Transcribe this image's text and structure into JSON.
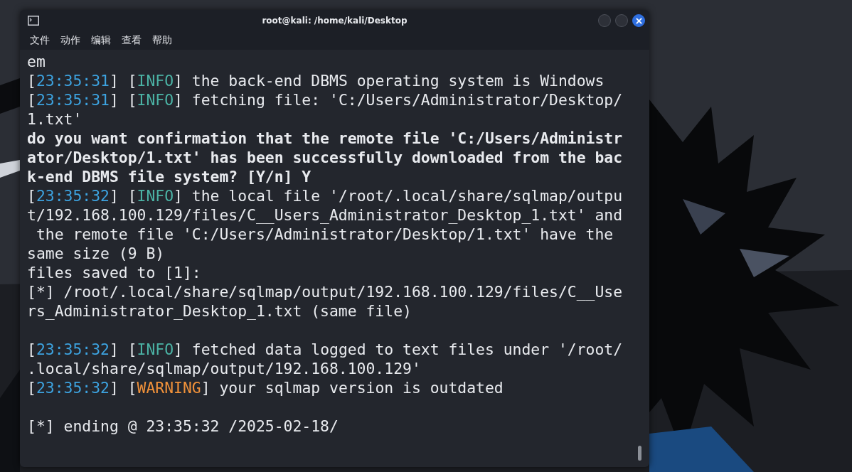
{
  "window": {
    "title": "root@kali: /home/kali/Desktop"
  },
  "menu": [
    "文件",
    "动作",
    "编辑",
    "查看",
    "帮助"
  ],
  "lines": [
    {
      "kind": "text",
      "segments": [
        {
          "kind": "plain",
          "text": "em"
        }
      ]
    },
    {
      "kind": "text",
      "segments": [
        {
          "kind": "plain",
          "text": "["
        },
        {
          "kind": "time",
          "text": "23:35:31"
        },
        {
          "kind": "plain",
          "text": "] ["
        },
        {
          "kind": "info",
          "text": "INFO"
        },
        {
          "kind": "plain",
          "text": "] the back-end DBMS operating system is Windows"
        }
      ]
    },
    {
      "kind": "text",
      "segments": [
        {
          "kind": "plain",
          "text": "["
        },
        {
          "kind": "time",
          "text": "23:35:31"
        },
        {
          "kind": "plain",
          "text": "] ["
        },
        {
          "kind": "info",
          "text": "INFO"
        },
        {
          "kind": "plain",
          "text": "] fetching file: 'C:/Users/Administrator/Desktop/"
        }
      ]
    },
    {
      "kind": "text",
      "segments": [
        {
          "kind": "plain",
          "text": "1.txt'"
        }
      ]
    },
    {
      "kind": "bold",
      "segments": [
        {
          "kind": "plain",
          "text": "do you want confirmation that the remote file 'C:/Users/Administr"
        }
      ]
    },
    {
      "kind": "bold",
      "segments": [
        {
          "kind": "plain",
          "text": "ator/Desktop/1.txt' has been successfully downloaded from the bac"
        }
      ]
    },
    {
      "kind": "bold",
      "segments": [
        {
          "kind": "plain",
          "text": "k-end DBMS file system? [Y/n] Y"
        }
      ]
    },
    {
      "kind": "text",
      "segments": [
        {
          "kind": "plain",
          "text": "["
        },
        {
          "kind": "time",
          "text": "23:35:32"
        },
        {
          "kind": "plain",
          "text": "] ["
        },
        {
          "kind": "info",
          "text": "INFO"
        },
        {
          "kind": "plain",
          "text": "] the local file '/root/.local/share/sqlmap/outpu"
        }
      ]
    },
    {
      "kind": "text",
      "segments": [
        {
          "kind": "plain",
          "text": "t/192.168.100.129/files/C__Users_Administrator_Desktop_1.txt' and"
        }
      ]
    },
    {
      "kind": "text",
      "segments": [
        {
          "kind": "plain",
          "text": " the remote file 'C:/Users/Administrator/Desktop/1.txt' have the"
        }
      ]
    },
    {
      "kind": "text",
      "segments": [
        {
          "kind": "plain",
          "text": "same size (9 B)"
        }
      ]
    },
    {
      "kind": "text",
      "segments": [
        {
          "kind": "plain",
          "text": "files saved to [1]:"
        }
      ]
    },
    {
      "kind": "text",
      "segments": [
        {
          "kind": "plain",
          "text": "[*] /root/.local/share/sqlmap/output/192.168.100.129/files/C__Use"
        }
      ]
    },
    {
      "kind": "text",
      "segments": [
        {
          "kind": "plain",
          "text": "rs_Administrator_Desktop_1.txt (same file)"
        }
      ]
    },
    {
      "kind": "blank"
    },
    {
      "kind": "text",
      "segments": [
        {
          "kind": "plain",
          "text": "["
        },
        {
          "kind": "time",
          "text": "23:35:32"
        },
        {
          "kind": "plain",
          "text": "] ["
        },
        {
          "kind": "info",
          "text": "INFO"
        },
        {
          "kind": "plain",
          "text": "] fetched data logged to text files under '/root/"
        }
      ]
    },
    {
      "kind": "text",
      "segments": [
        {
          "kind": "plain",
          "text": ".local/share/sqlmap/output/192.168.100.129'"
        }
      ]
    },
    {
      "kind": "text",
      "segments": [
        {
          "kind": "plain",
          "text": "["
        },
        {
          "kind": "time",
          "text": "23:35:32"
        },
        {
          "kind": "plain",
          "text": "] ["
        },
        {
          "kind": "warning",
          "text": "WARNING"
        },
        {
          "kind": "plain",
          "text": "] your sqlmap version is outdated"
        }
      ]
    },
    {
      "kind": "blank"
    },
    {
      "kind": "text",
      "segments": [
        {
          "kind": "plain",
          "text": "[*] ending @ 23:35:32 /2025-02-18/"
        }
      ]
    }
  ]
}
